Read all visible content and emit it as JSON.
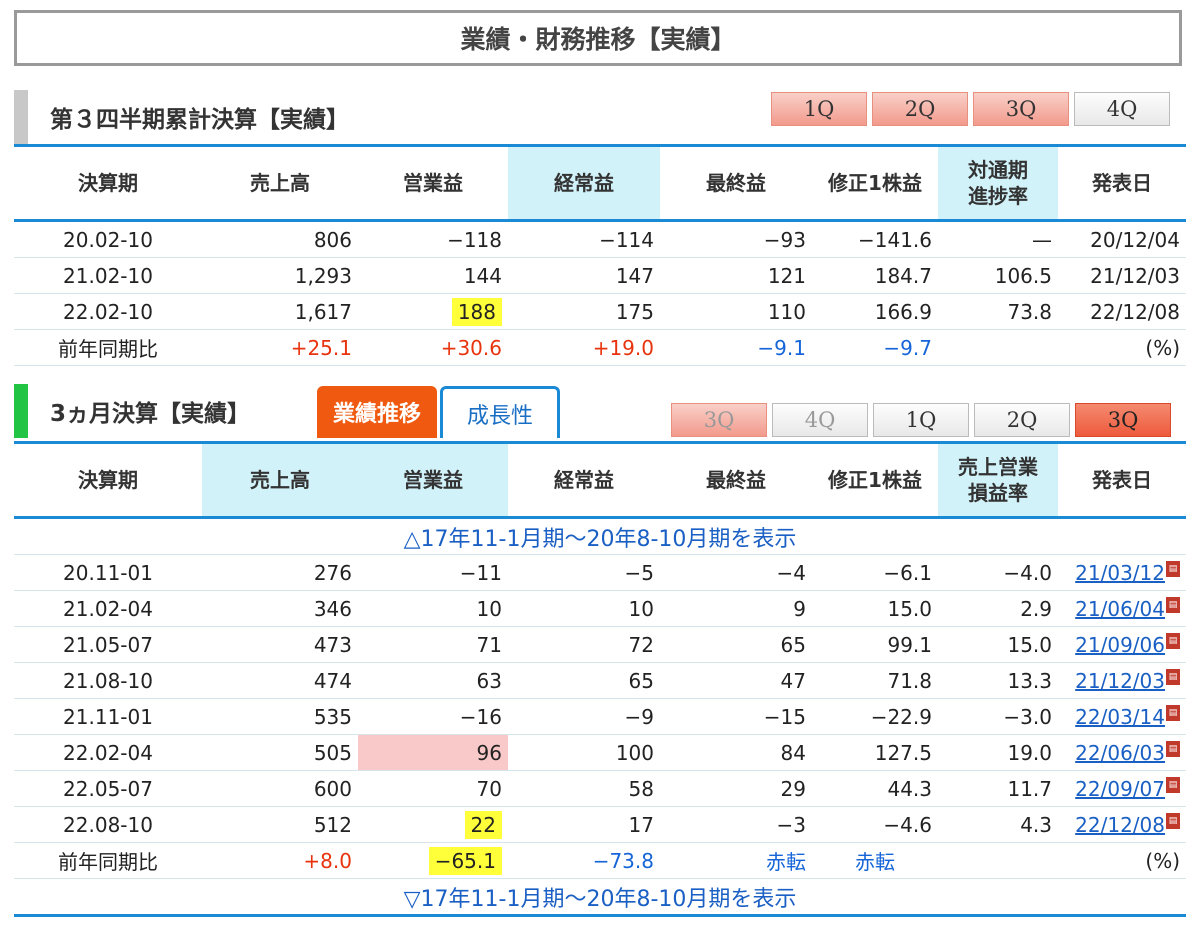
{
  "page_title": "業績・財務推移【実績】",
  "section1": {
    "title": "第３四半期累計決算【実績】",
    "tabs": [
      "1Q",
      "2Q",
      "3Q",
      "4Q"
    ],
    "headers": [
      "決算期",
      "売上高",
      "営業益",
      "経常益",
      "最終益",
      "修正1株益",
      "対通期進捗率",
      "発表日"
    ],
    "headers_split": {
      "progress_1": "対通期",
      "progress_2": "進捗率"
    },
    "rows": [
      [
        "20.02-10",
        "806",
        "−118",
        "−114",
        "−93",
        "−141.6",
        "—",
        "20/12/04"
      ],
      [
        "21.02-10",
        "1,293",
        "144",
        "147",
        "121",
        "184.7",
        "106.5",
        "21/12/03"
      ],
      [
        "22.02-10",
        "1,617",
        "188",
        "175",
        "110",
        "166.9",
        "73.8",
        "22/12/08"
      ]
    ],
    "yoy": {
      "label": "前年同期比",
      "values": [
        "+25.1",
        "+30.6",
        "+19.0",
        "−9.1",
        "−9.7"
      ],
      "unit": "(%)"
    }
  },
  "section2": {
    "title": "3ヵ月決算【実績】",
    "tab_gyoseki": "業績推移",
    "tab_seicho": "成長性",
    "tabs": [
      "3Q",
      "4Q",
      "1Q",
      "2Q",
      "3Q"
    ],
    "headers": [
      "決算期",
      "売上高",
      "営業益",
      "経常益",
      "最終益",
      "修正1株益"
    ],
    "margin_1": "売上営業",
    "margin_2": "損益率",
    "date_header": "発表日",
    "expand_top": "△17年11-1月期～20年8-10月期を表示",
    "expand_bottom": "▽17年11-1月期～20年8-10月期を表示",
    "rows": [
      [
        "20.11-01",
        "276",
        "−11",
        "−5",
        "−4",
        "−6.1",
        "−4.0",
        "21/03/12"
      ],
      [
        "21.02-04",
        "346",
        "10",
        "10",
        "9",
        "15.0",
        "2.9",
        "21/06/04"
      ],
      [
        "21.05-07",
        "473",
        "71",
        "72",
        "65",
        "99.1",
        "15.0",
        "21/09/06"
      ],
      [
        "21.08-10",
        "474",
        "63",
        "65",
        "47",
        "71.8",
        "13.3",
        "21/12/03"
      ],
      [
        "21.11-01",
        "535",
        "−16",
        "−9",
        "−15",
        "−22.9",
        "−3.0",
        "22/03/14"
      ],
      [
        "22.02-04",
        "505",
        "96",
        "100",
        "84",
        "127.5",
        "19.0",
        "22/06/03"
      ],
      [
        "22.05-07",
        "600",
        "70",
        "58",
        "29",
        "44.3",
        "11.7",
        "22/09/07"
      ],
      [
        "22.08-10",
        "512",
        "22",
        "17",
        "−3",
        "−4.6",
        "4.3",
        "22/12/08"
      ]
    ],
    "yoy": {
      "label": "前年同期比",
      "values": [
        "+8.0",
        "−65.1",
        "−73.8",
        "赤転",
        "赤転"
      ],
      "unit": "(%)"
    }
  },
  "colors": {
    "accent_blue": "#1a8ad4",
    "header_highlight": "#d2f2fa",
    "positive": "#e8340e",
    "negative": "#1565d8",
    "highlight_yellow": "#ffff3a",
    "tab_orange": "#f05a10",
    "section_green": "#22c444",
    "section_gray": "#c8c8c8"
  },
  "icons": {
    "pdf": "pdf-icon"
  }
}
